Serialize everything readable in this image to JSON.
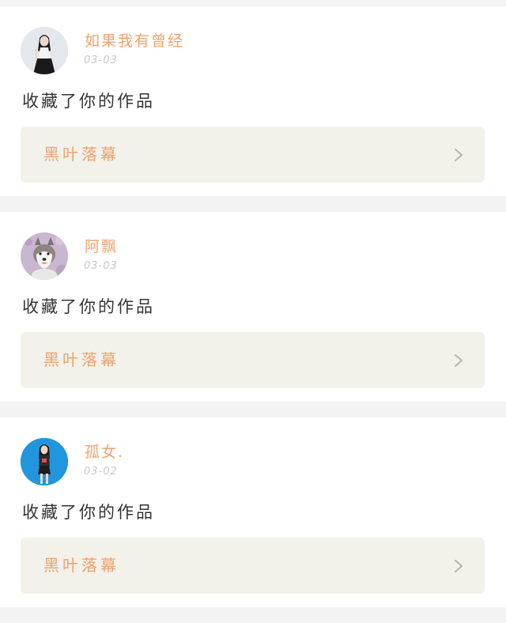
{
  "feed": [
    {
      "username": "如果我有曾经",
      "date": "03-03",
      "action": "收藏了你的作品",
      "work_title": "黑叶落幕",
      "avatar_icon": "avatar-girl-dark-hair",
      "chevron_icon": "chevron-right-icon"
    },
    {
      "username": "阿飘",
      "date": "03-03",
      "action": "收藏了你的作品",
      "work_title": "黑叶落幕",
      "avatar_icon": "avatar-husky-dog",
      "chevron_icon": "chevron-right-icon"
    },
    {
      "username": "孤女.",
      "date": "03-02",
      "action": "收藏了你的作品",
      "work_title": "黑叶落幕",
      "avatar_icon": "avatar-girl-blue-background",
      "chevron_icon": "chevron-right-icon"
    }
  ],
  "colors": {
    "accent": "#f0a26a",
    "card_background": "#ffffff",
    "link_background": "#f2f2ea",
    "page_background": "#f3f3f3",
    "date_text": "#c8c8c8",
    "body_text": "#333333"
  }
}
